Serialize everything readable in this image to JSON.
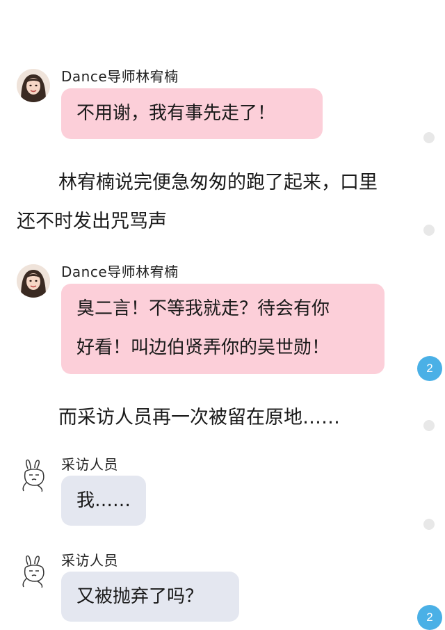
{
  "messages": [
    {
      "sender": "Dance导师林宥楠",
      "text": "不用谢，我有事先走了！"
    },
    {
      "sender": "Dance导师林宥楠",
      "lines": [
        "臭二言！不等我就走？待会有你",
        "好看！叫边伯贤弄你的吴世勋！"
      ]
    },
    {
      "sender": "采访人员",
      "text": "我……"
    },
    {
      "sender": "采访人员",
      "text": "又被抛弃了吗？"
    }
  ],
  "narration": {
    "para1_line1": "林宥楠说完便急匆匆的跑了起来，口里",
    "para1_line2": "还不时发出咒骂声",
    "para2": "而采访人员再一次被留在原地……"
  },
  "badges": {
    "badge1": "2",
    "badge2": "2"
  },
  "colors": {
    "pink_bubble": "#fccfd9",
    "gray_bubble": "#e4e7f0",
    "badge": "#4ab0e6"
  }
}
